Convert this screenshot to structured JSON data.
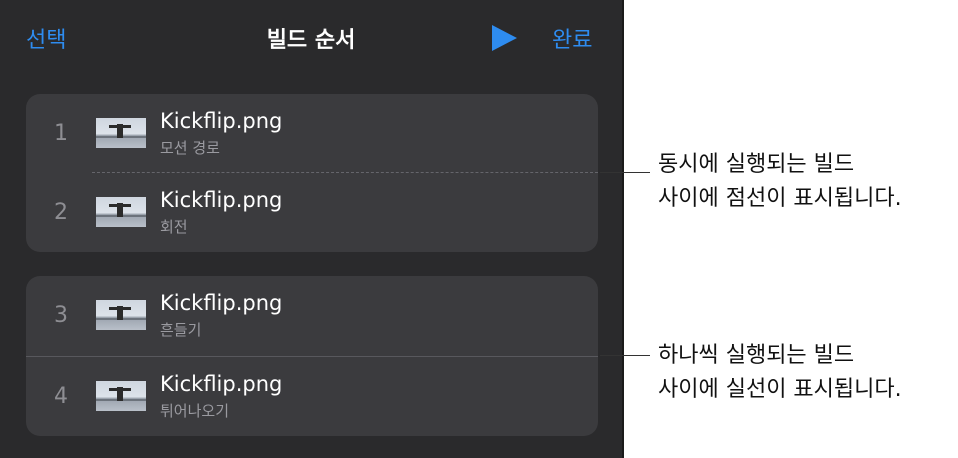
{
  "nav": {
    "select_label": "선택",
    "title": "빌드 순서",
    "play_icon": "play-icon",
    "done_label": "완료",
    "accent": "#2e8cf0"
  },
  "groups": [
    {
      "items": [
        {
          "number": "1",
          "file": "Kickflip.png",
          "effect": "모션 경로"
        },
        {
          "number": "2",
          "file": "Kickflip.png",
          "effect": "회전"
        }
      ]
    },
    {
      "items": [
        {
          "number": "3",
          "file": "Kickflip.png",
          "effect": "흔들기"
        },
        {
          "number": "4",
          "file": "Kickflip.png",
          "effect": "튀어나오기"
        }
      ]
    }
  ],
  "callouts": [
    {
      "line1": "동시에 실행되는 빌드",
      "line2": "사이에 점선이 표시됩니다."
    },
    {
      "line1": "하나씩 실행되는 빌드",
      "line2": "사이에 실선이 표시됩니다."
    }
  ]
}
